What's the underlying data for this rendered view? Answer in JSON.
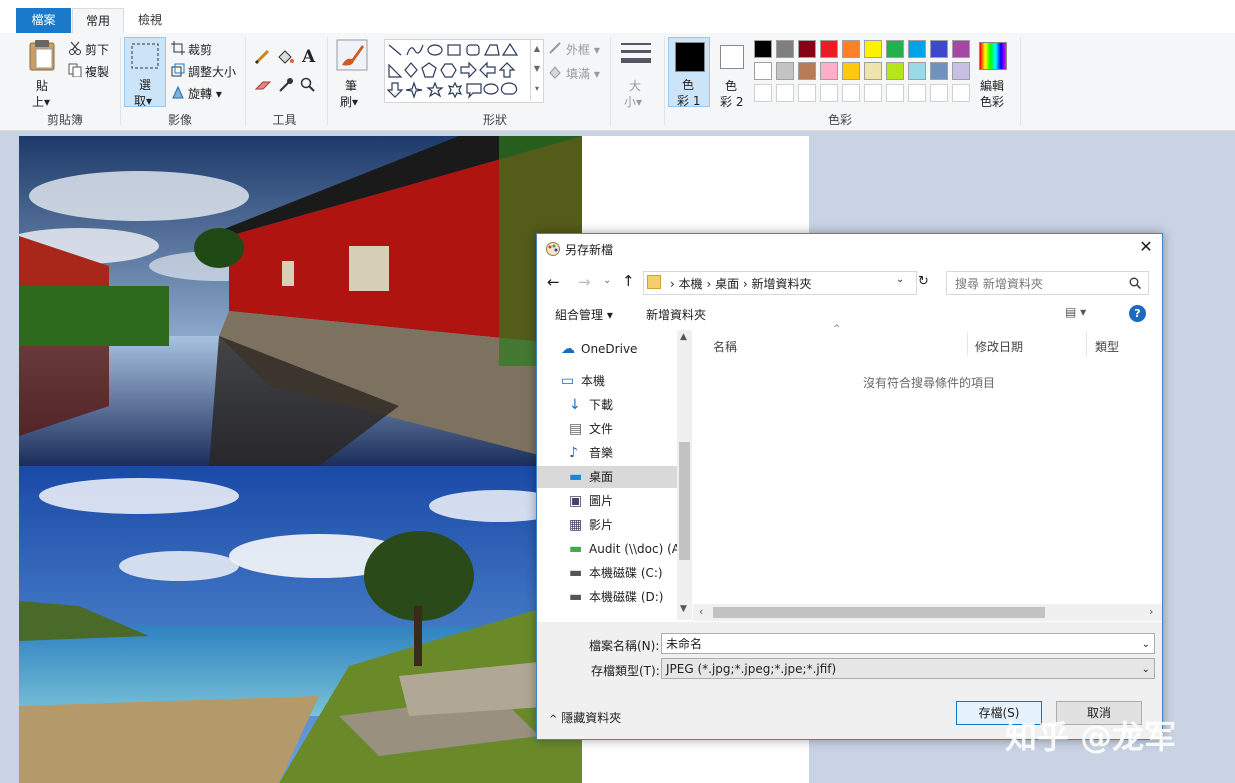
{
  "tabs": {
    "file": "檔案",
    "home": "常用",
    "view": "檢視"
  },
  "ribbon": {
    "clipboard": {
      "paste_l1": "貼",
      "paste_l2": "上",
      "cut": "剪下",
      "copy": "複製",
      "group": "剪貼簿"
    },
    "image": {
      "select_l1": "選",
      "select_l2": "取",
      "crop": "裁剪",
      "resize": "調整大小",
      "rotate": "旋轉",
      "group": "影像"
    },
    "tools": {
      "group": "工具"
    },
    "brushes": {
      "l1": "筆",
      "l2": "刷"
    },
    "shapes": {
      "outline": "外框",
      "fill": "填滿",
      "group": "形狀"
    },
    "size": {
      "l1": "大",
      "l2": "小"
    },
    "colors": {
      "color1_l1": "色",
      "color1_l2": "彩 1",
      "color2_l1": "色",
      "color2_l2": "彩 2",
      "edit_l1": "編輯",
      "edit_l2": "色彩",
      "group": "色彩",
      "color1_value": "#000000",
      "color2_value": "#ffffff",
      "palette_row1": [
        "#000000",
        "#7f7f7f",
        "#880015",
        "#ed1c24",
        "#ff7f27",
        "#fff200",
        "#22b14c",
        "#00a2e8",
        "#3f48cc",
        "#a349a4"
      ],
      "palette_row2": [
        "#ffffff",
        "#c3c3c3",
        "#b97a57",
        "#ffaec9",
        "#ffc90e",
        "#efe4b0",
        "#b5e61d",
        "#99d9ea",
        "#7092be",
        "#c8bfe7"
      ]
    }
  },
  "dialog": {
    "title": "另存新檔",
    "breadcrumb": [
      "本機",
      "桌面",
      "新增資料夾"
    ],
    "search_placeholder": "搜尋 新增資料夾",
    "toolbar": {
      "organize": "組合管理",
      "new_folder": "新增資料夾"
    },
    "nav": [
      {
        "label": "OneDrive",
        "icon": "cloud-icon"
      },
      {
        "label": "本機",
        "icon": "computer-icon"
      },
      {
        "label": "下載",
        "icon": "download-icon"
      },
      {
        "label": "文件",
        "icon": "document-icon"
      },
      {
        "label": "音樂",
        "icon": "music-icon"
      },
      {
        "label": "桌面",
        "icon": "desktop-icon"
      },
      {
        "label": "圖片",
        "icon": "pictures-icon"
      },
      {
        "label": "影片",
        "icon": "videos-icon"
      },
      {
        "label": "Audit (\\\\doc) (A",
        "icon": "network-drive-icon"
      },
      {
        "label": "本機磁碟 (C:)",
        "icon": "drive-icon"
      },
      {
        "label": "本機磁碟 (D:)",
        "icon": "drive-icon"
      }
    ],
    "columns": {
      "name": "名稱",
      "modified": "修改日期",
      "type": "類型"
    },
    "empty_message": "沒有符合搜尋條件的項目",
    "filename_label": "檔案名稱(N):",
    "filename_value": "未命名",
    "filetype_label": "存檔類型(T):",
    "filetype_value": "JPEG (*.jpg;*.jpeg;*.jpe;*.jfif)",
    "hide_folders": "隱藏資料夾",
    "save_button": "存檔(S)",
    "cancel_button": "取消"
  },
  "watermark": "知乎 @龙军"
}
